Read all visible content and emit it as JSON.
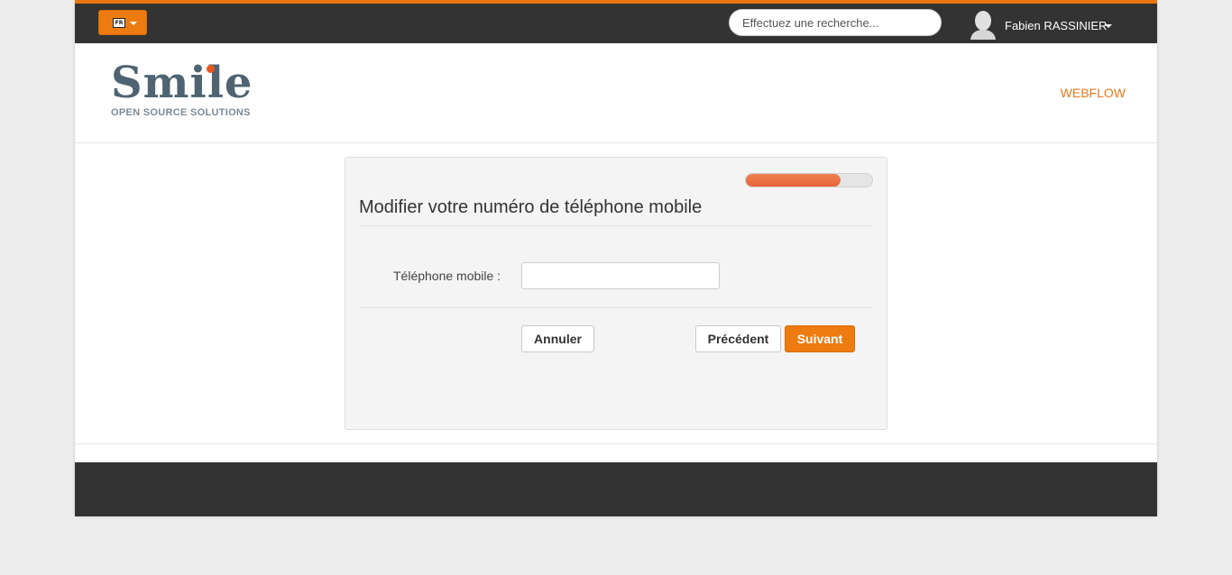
{
  "topbar": {
    "language": {
      "code": "FR"
    },
    "search": {
      "placeholder": "Effectuez une recherche..."
    },
    "user": {
      "name": "Fabien RASSINIER"
    },
    "accent_color": "#e87511"
  },
  "header": {
    "logo": {
      "word": "Smile",
      "tagline": "OPEN SOURCE SOLUTIONS"
    },
    "nav": {
      "webflow_label": "WEBFLOW"
    }
  },
  "form": {
    "progress": 0.75,
    "title": "Modifier votre numéro de téléphone mobile",
    "phone_label": "Téléphone mobile :",
    "phone_value": "",
    "buttons": {
      "cancel": "Annuler",
      "previous": "Précédent",
      "next": "Suivant"
    }
  },
  "colors": {
    "primary": "#ee7b10",
    "dark": "#333333",
    "progress_fill": "#e8643a"
  },
  "icons": {
    "user_avatar": "user-silhouette-icon",
    "language_flag": "flag-icon",
    "dropdown": "caret-down-icon"
  }
}
